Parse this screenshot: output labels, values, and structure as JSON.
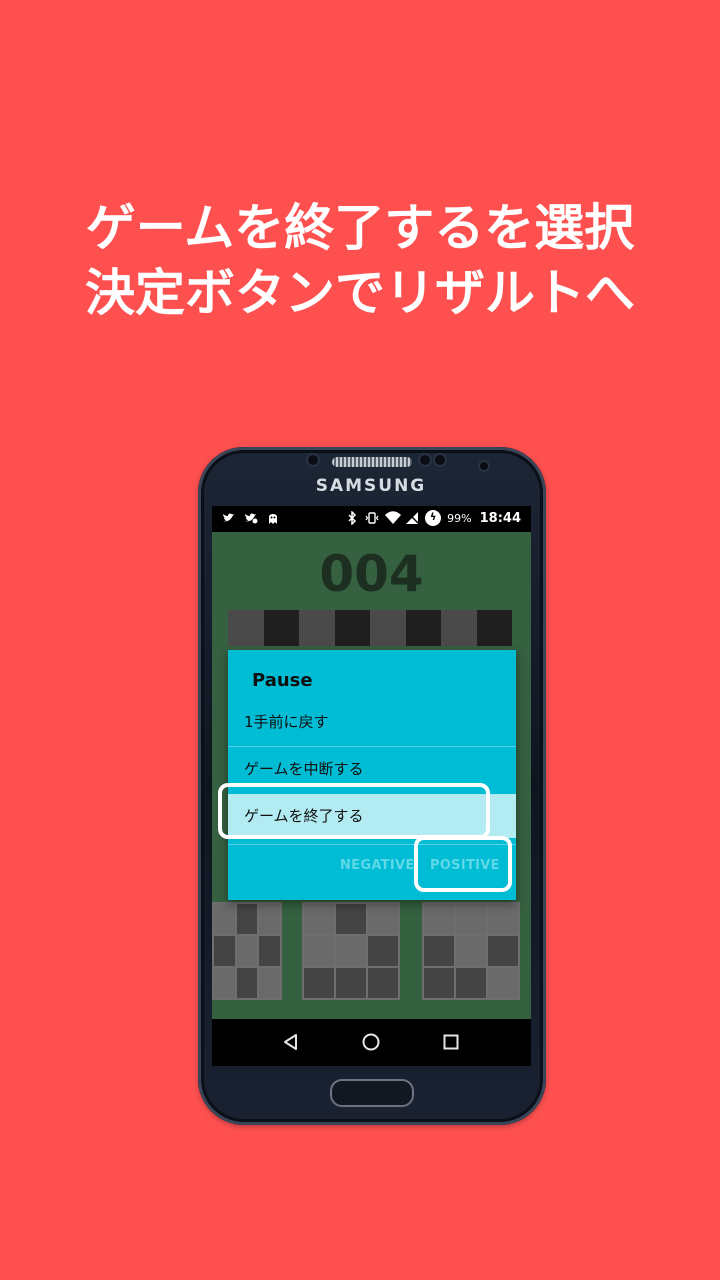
{
  "headline": {
    "line1": "ゲームを終了するを選択",
    "line2": "決定ボタンでリザルトへ"
  },
  "device": {
    "brand": "SAMSUNG"
  },
  "status_bar": {
    "left_icons": [
      "twitter-icon",
      "twitter-alt-icon",
      "ghost-icon"
    ],
    "right_icons": [
      "bluetooth-icon",
      "vibrate-icon",
      "wifi-icon",
      "no-signal-icon"
    ],
    "battery_percent": "99%",
    "time": "18:44"
  },
  "game": {
    "counter": "004"
  },
  "dialog": {
    "title": "Pause",
    "items": [
      {
        "label": "1手前に戻す"
      },
      {
        "label": "ゲームを中断する"
      },
      {
        "label": "ゲームを終了する",
        "selected": true
      }
    ],
    "negative_label": "NEGATIVE",
    "positive_label": "POSITIVE"
  },
  "nav_bar": {
    "icons": [
      "back-icon",
      "home-icon",
      "recents-icon"
    ]
  },
  "colors": {
    "background": "#FF5050",
    "dialog": "#00BCD4",
    "selected_item": "#B2EBF2",
    "game_board": "#356140"
  }
}
